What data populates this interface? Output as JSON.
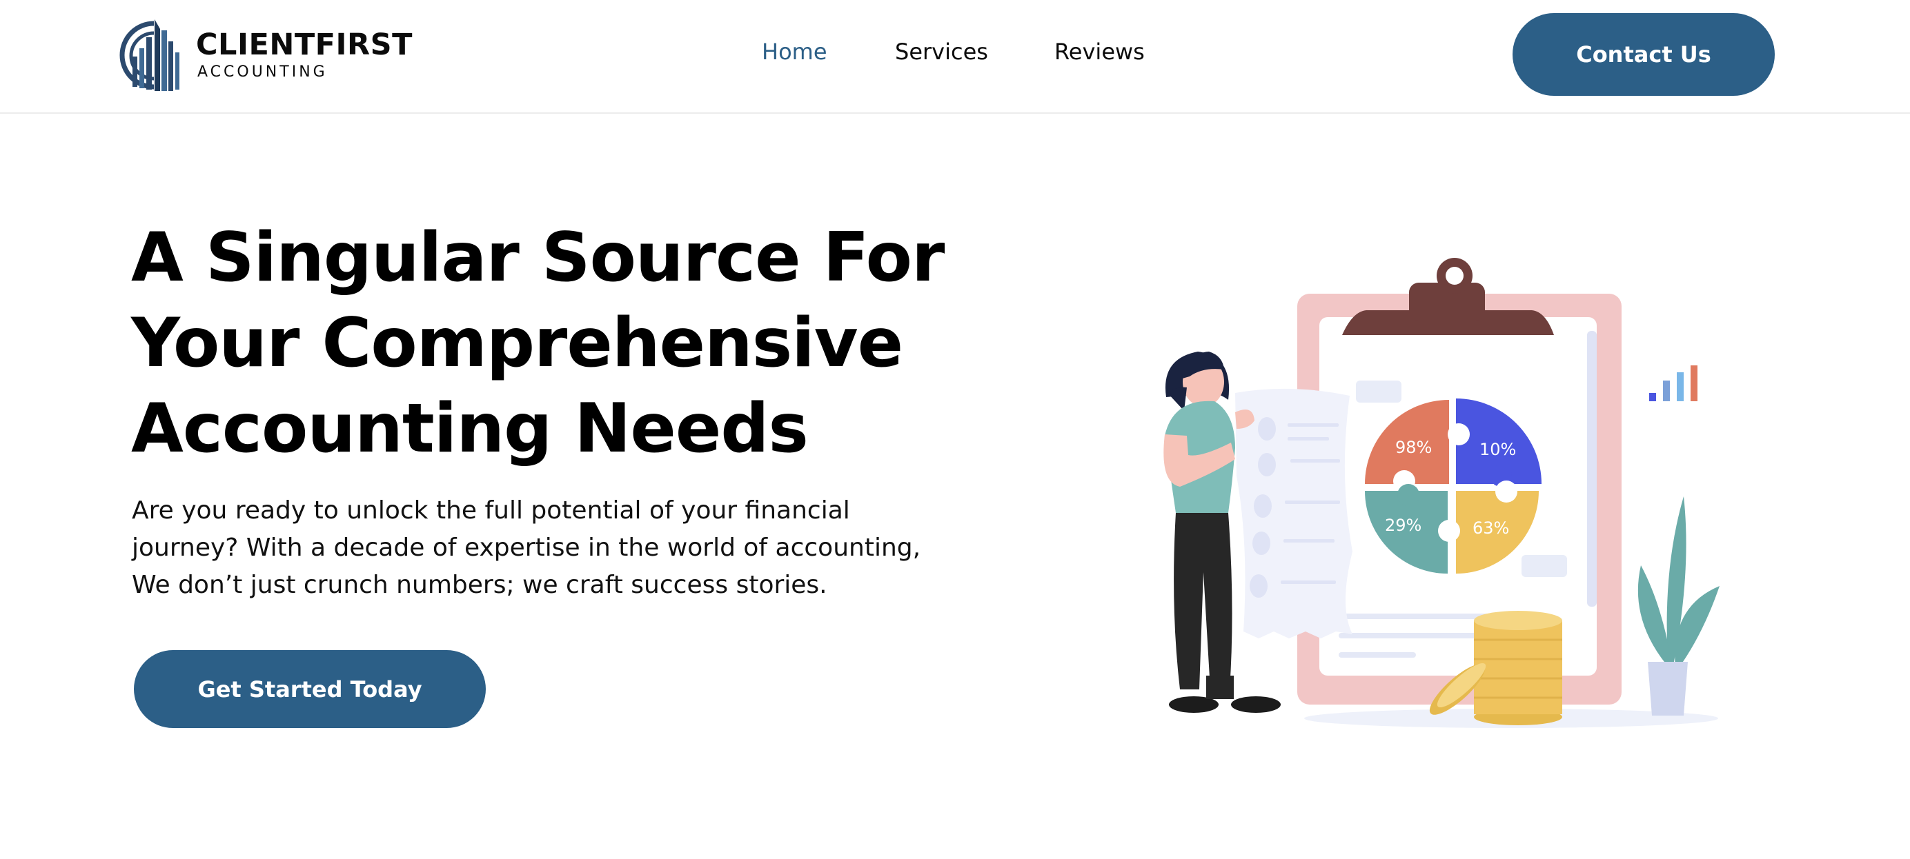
{
  "brand": {
    "name": "CLIENTFIRST",
    "sub": "ACCOUNTING",
    "color": "#2c5f87"
  },
  "nav": {
    "items": [
      {
        "label": "Home",
        "active": true
      },
      {
        "label": "Services",
        "active": false
      },
      {
        "label": "Reviews",
        "active": false
      }
    ],
    "contact_label": "Contact Us"
  },
  "hero": {
    "title_lines": [
      "A Singular Source For",
      "Your Comprehensive",
      "Accounting Needs"
    ],
    "description_lines": [
      "Are you ready to unlock the full potential of your financial",
      "journey? With a decade of expertise in the world of accounting,",
      "We don’t just crunch numbers; we craft success stories."
    ],
    "cta_label": "Get Started Today"
  },
  "illustration": {
    "pie_labels": [
      "98%",
      "10%",
      "29%",
      "63%"
    ],
    "colors": {
      "orange": "#e07a5f",
      "blue": "#4a55e0",
      "teal": "#6aaba8",
      "yellow": "#efc35d",
      "clipboard": "#f2c6c6",
      "clip": "#6e3f3c"
    }
  }
}
